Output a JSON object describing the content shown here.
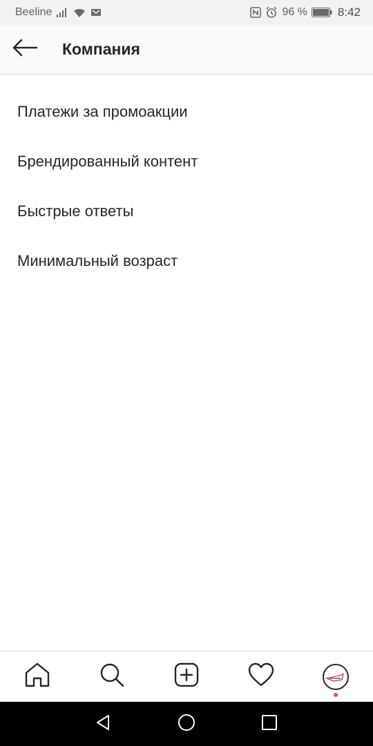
{
  "status_bar": {
    "carrier": "Beeline",
    "battery_percent": "96 %",
    "time": "8:42",
    "icons": [
      "signal-icon",
      "wifi-icon",
      "mail-icon",
      "nfc-icon",
      "alarm-icon",
      "battery-icon"
    ]
  },
  "header": {
    "title": "Компания",
    "back_icon": "arrow-left-icon"
  },
  "menu": {
    "items": [
      {
        "label": "Платежи за промоакции"
      },
      {
        "label": "Брендированный контент"
      },
      {
        "label": "Быстрые ответы"
      },
      {
        "label": "Минимальный возраст"
      }
    ]
  },
  "bottom_nav": {
    "items": [
      "home-icon",
      "search-icon",
      "add-post-icon",
      "activity-heart-icon",
      "profile-avatar"
    ],
    "notification_dot_color": "#ed4956"
  },
  "system_nav": {
    "items": [
      "back-triangle-icon",
      "home-circle-icon",
      "recents-square-icon"
    ]
  },
  "colors": {
    "text": "#262626",
    "header_bg": "#fafafa",
    "status_bg": "#f2f2f2",
    "divider": "#dbdbdb",
    "system_bar": "#000000"
  }
}
